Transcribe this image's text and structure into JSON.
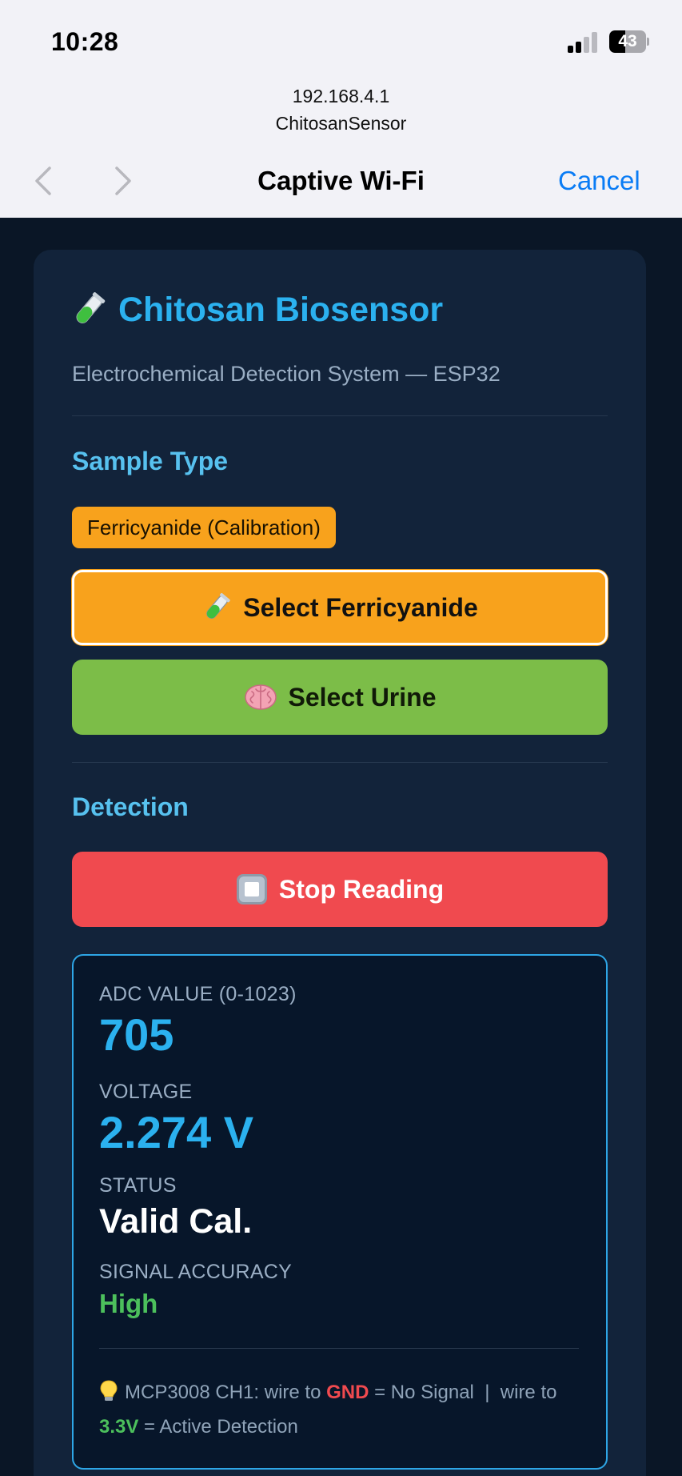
{
  "status_bar": {
    "time": "10:28",
    "battery_level": "43",
    "battery_fraction": 0.43,
    "signal_bars_active": 2,
    "signal_bars_total": 4
  },
  "browser": {
    "url_host": "192.168.4.1",
    "url_name": "ChitosanSensor",
    "title": "Captive Wi-Fi",
    "cancel_label": "Cancel",
    "back_icon": "chevron-left-icon",
    "forward_icon": "chevron-right-icon"
  },
  "app": {
    "title": "Chitosan Biosensor",
    "title_icon": "test-tube-icon",
    "subtitle": "Electrochemical Detection System — ESP32"
  },
  "sample_type": {
    "heading": "Sample Type",
    "current_badge": "Ferricyanide (Calibration)",
    "ferri_button": "Select Ferricyanide",
    "ferri_icon": "test-tube-icon",
    "urine_button": "Select Urine",
    "urine_icon": "brain-icon"
  },
  "detection": {
    "heading": "Detection",
    "stop_button": "Stop Reading",
    "stop_icon": "stop-square-icon",
    "adc_label": "ADC VALUE (0-1023)",
    "adc_value": "705",
    "voltage_label": "VOLTAGE",
    "voltage_value": "2.274 V",
    "status_label": "STATUS",
    "status_value": "Valid Cal.",
    "accuracy_label": "SIGNAL ACCURACY",
    "accuracy_value": "High",
    "note_icon": "lightbulb-icon",
    "note_prefix": "MCP3008 CH1: wire to",
    "note_gnd": "GND",
    "note_mid": "= No Signal  |  wire to",
    "note_v33": "3.3V",
    "note_suffix": "= Active Detection"
  },
  "colors": {
    "accent_blue": "#2bb1ef",
    "orange": "#f8a21c",
    "green": "#7cbd48",
    "red": "#f04a4f",
    "ios_blue": "#0a7cf5",
    "background": "#0a1626"
  }
}
